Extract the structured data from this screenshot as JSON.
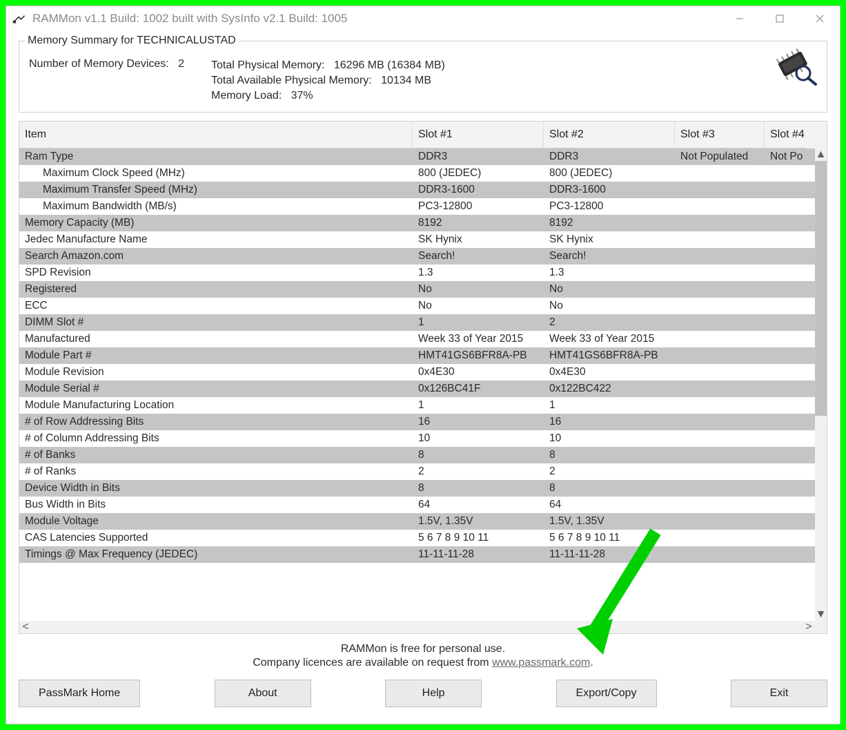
{
  "window_title": "RAMMon v1.1 Build: 1002 built with SysInfo v2.1 Build: 1005",
  "summary": {
    "legend": "Memory Summary for TECHNICALUSTAD",
    "num_devices_label": "Number of Memory Devices:",
    "num_devices_value": "2",
    "total_phys_label": "Total Physical Memory:",
    "total_phys_value": "16296 MB (16384 MB)",
    "total_avail_label": "Total Available Physical Memory:",
    "total_avail_value": "10134 MB",
    "mem_load_label": "Memory Load:",
    "mem_load_value": "37%"
  },
  "table": {
    "headers": [
      "Item",
      "Slot #1",
      "Slot #2",
      "Slot #3",
      "Slot #4"
    ],
    "rows": [
      {
        "label": "Ram Type",
        "s1": "DDR3",
        "s2": "DDR3",
        "s3": "Not Populated",
        "s4": "Not Po"
      },
      {
        "label": "Maximum Clock Speed (MHz)",
        "indent": true,
        "s1": "800 (JEDEC)",
        "s2": "800 (JEDEC)",
        "s3": "",
        "s4": ""
      },
      {
        "label": "Maximum Transfer Speed (MHz)",
        "indent": true,
        "s1": "DDR3-1600",
        "s2": "DDR3-1600",
        "s3": "",
        "s4": ""
      },
      {
        "label": "Maximum Bandwidth (MB/s)",
        "indent": true,
        "s1": "PC3-12800",
        "s2": "PC3-12800",
        "s3": "",
        "s4": ""
      },
      {
        "label": "Memory Capacity (MB)",
        "s1": "8192",
        "s2": "8192",
        "s3": "",
        "s4": ""
      },
      {
        "label": "Jedec Manufacture Name",
        "s1": "SK Hynix",
        "s2": "SK Hynix",
        "s3": "",
        "s4": ""
      },
      {
        "label": "Search Amazon.com",
        "s1": "Search!",
        "s2": "Search!",
        "s3": "",
        "s4": "",
        "link": true
      },
      {
        "label": "SPD Revision",
        "s1": "1.3",
        "s2": "1.3",
        "s3": "",
        "s4": ""
      },
      {
        "label": "Registered",
        "s1": "No",
        "s2": "No",
        "s3": "",
        "s4": ""
      },
      {
        "label": "ECC",
        "s1": "No",
        "s2": "No",
        "s3": "",
        "s4": ""
      },
      {
        "label": "DIMM Slot #",
        "s1": "1",
        "s2": "2",
        "s3": "",
        "s4": ""
      },
      {
        "label": "Manufactured",
        "s1": "Week 33 of Year 2015",
        "s2": "Week 33 of Year 2015",
        "s3": "",
        "s4": ""
      },
      {
        "label": "Module Part #",
        "s1": "HMT41GS6BFR8A-PB",
        "s2": "HMT41GS6BFR8A-PB",
        "s3": "",
        "s4": ""
      },
      {
        "label": "Module Revision",
        "s1": "0x4E30",
        "s2": "0x4E30",
        "s3": "",
        "s4": ""
      },
      {
        "label": "Module Serial #",
        "s1": "0x126BC41F",
        "s2": "0x122BC422",
        "s3": "",
        "s4": ""
      },
      {
        "label": "Module Manufacturing Location",
        "s1": "1",
        "s2": "1",
        "s3": "",
        "s4": ""
      },
      {
        "label": "# of Row Addressing Bits",
        "s1": "16",
        "s2": "16",
        "s3": "",
        "s4": ""
      },
      {
        "label": "# of Column Addressing Bits",
        "s1": "10",
        "s2": "10",
        "s3": "",
        "s4": ""
      },
      {
        "label": "# of Banks",
        "s1": "8",
        "s2": "8",
        "s3": "",
        "s4": ""
      },
      {
        "label": "# of Ranks",
        "s1": "2",
        "s2": "2",
        "s3": "",
        "s4": ""
      },
      {
        "label": "Device Width in Bits",
        "s1": "8",
        "s2": "8",
        "s3": "",
        "s4": ""
      },
      {
        "label": "Bus Width in Bits",
        "s1": "64",
        "s2": "64",
        "s3": "",
        "s4": ""
      },
      {
        "label": "Module Voltage",
        "s1": "1.5V, 1.35V",
        "s2": "1.5V, 1.35V",
        "s3": "",
        "s4": ""
      },
      {
        "label": "CAS Latencies Supported",
        "s1": "5 6 7 8 9 10 11",
        "s2": "5 6 7 8 9 10 11",
        "s3": "",
        "s4": ""
      },
      {
        "label": "Timings @ Max Frequency (JEDEC)",
        "s1": "11-11-11-28",
        "s2": "11-11-11-28",
        "s3": "",
        "s4": ""
      }
    ]
  },
  "footer": {
    "line1": "RAMMon is free for personal use.",
    "line2_pre": "Company licences are available on request from ",
    "line2_link": "www.passmark.com",
    "line2_post": "."
  },
  "buttons": {
    "home": "PassMark Home",
    "about": "About",
    "help": "Help",
    "export": "Export/Copy",
    "exit": "Exit"
  }
}
